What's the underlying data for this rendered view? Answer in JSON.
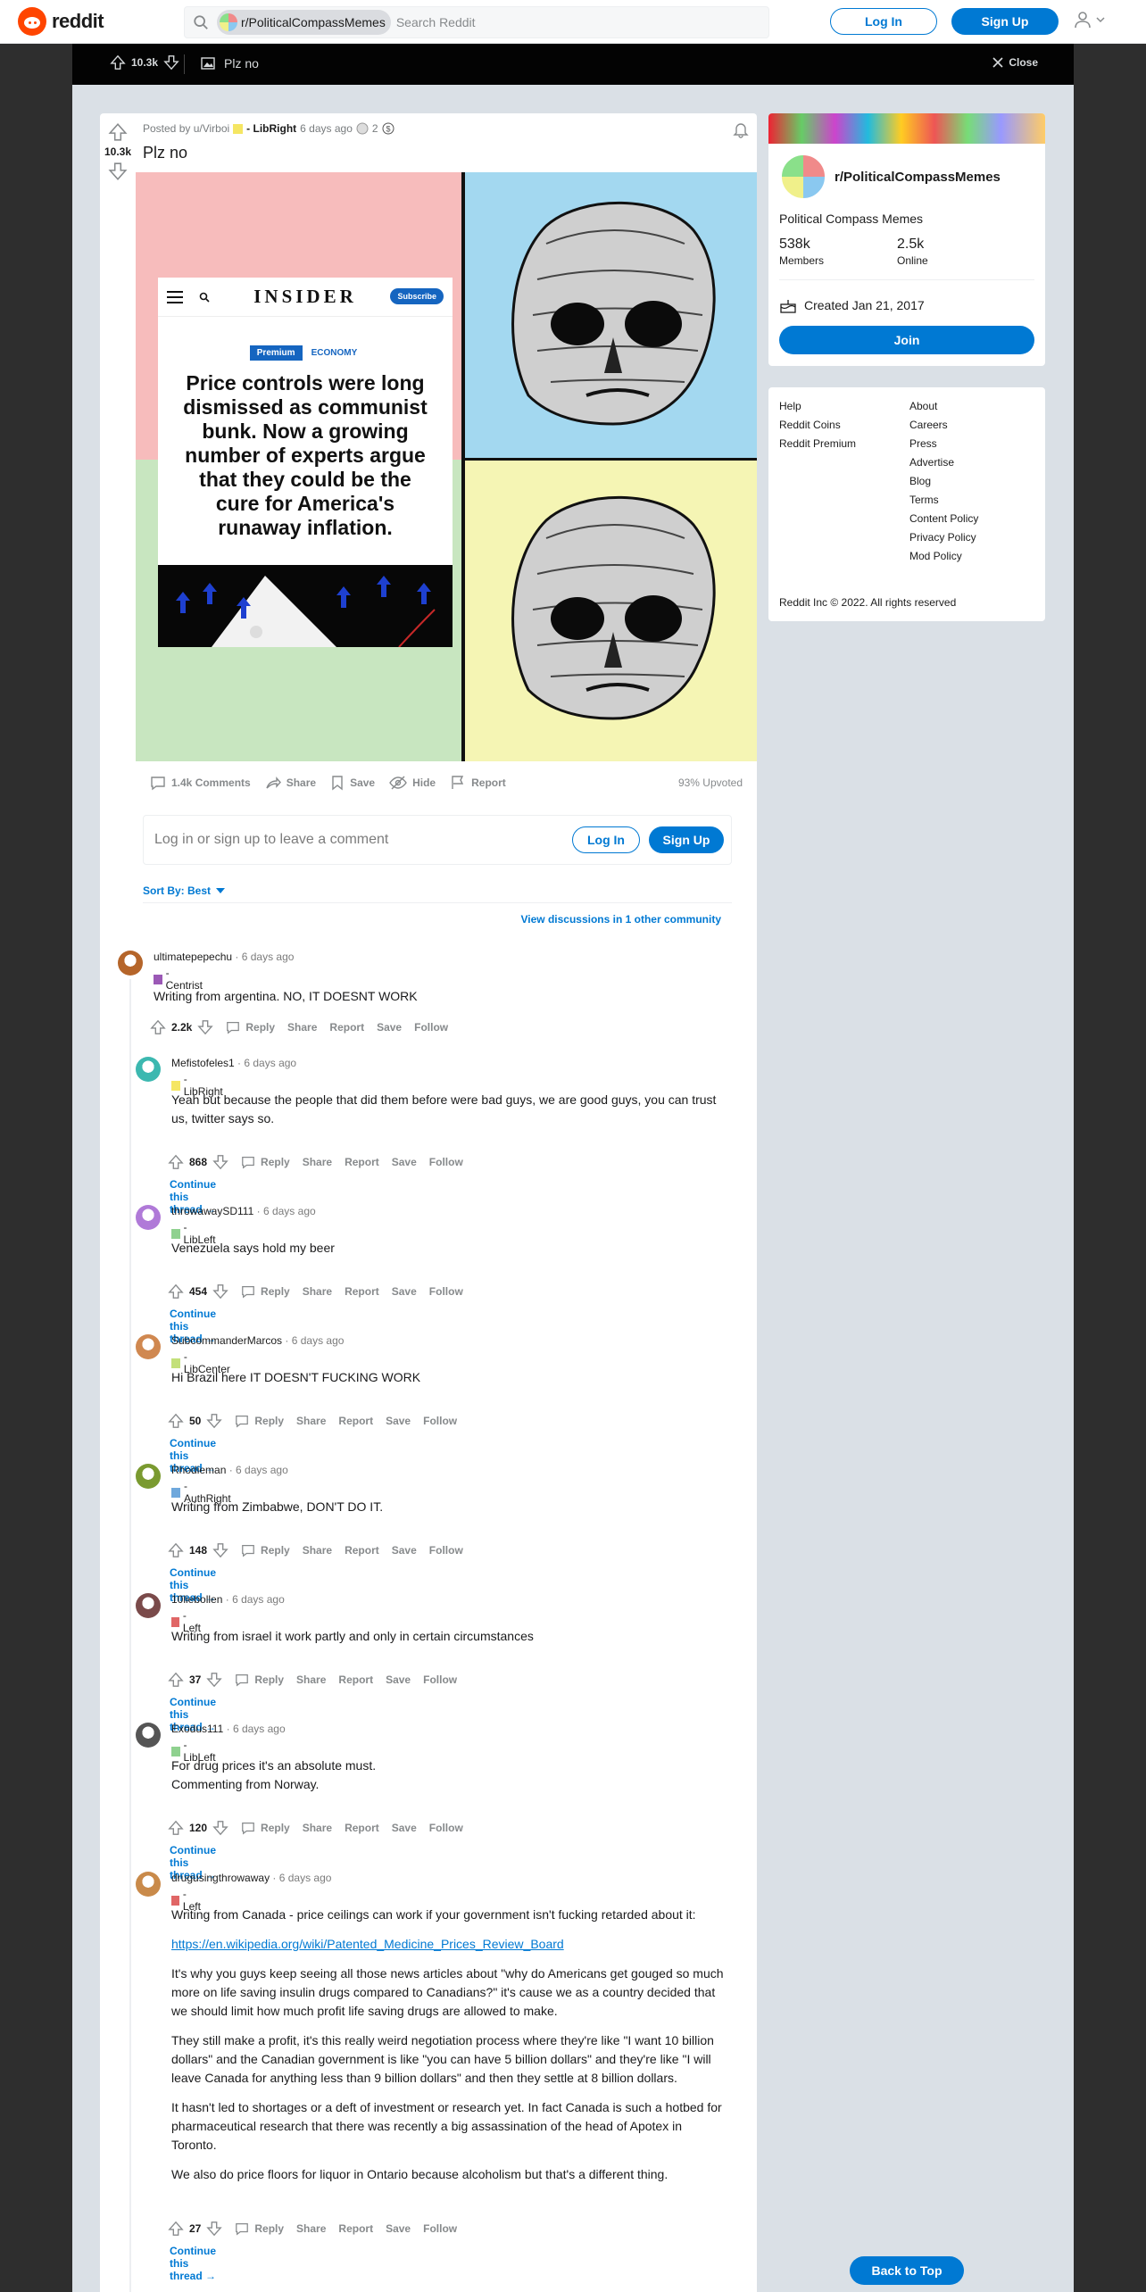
{
  "header": {
    "logo_text": "reddit",
    "subreddit_pill": "r/PoliticalCompassMemes",
    "search_placeholder": "Search Reddit",
    "login_label": "Log In",
    "signup_label": "Sign Up"
  },
  "topbar": {
    "vote_count": "10.3k",
    "title": "Plz no",
    "close_label": "Close"
  },
  "post": {
    "posted_by": "Posted by u/Virboi",
    "author_flair": "- LibRight",
    "time": "6 days ago",
    "award_count": "2",
    "vote_count": "10.3k",
    "title": "Plz no",
    "meme": {
      "brand": "INSIDER",
      "subscribe": "Subscribe",
      "tag_premium": "Premium",
      "tag_section": "ECONOMY",
      "headline": "Price controls were long dismissed as communist bunk. Now a growing number of experts argue that they could be the cure for America's runaway inflation."
    },
    "actions": {
      "comments": "1.4k Comments",
      "share": "Share",
      "save": "Save",
      "hide": "Hide",
      "report": "Report",
      "upvoted": "93% Upvoted"
    }
  },
  "comment_box": {
    "prompt": "Log in or sign up to leave a comment",
    "login": "Log In",
    "signup": "Sign Up"
  },
  "sort_label": "Sort By: Best",
  "view_discussions": "View discussions in 1 other community",
  "comment_actions": {
    "reply": "Reply",
    "share": "Share",
    "report": "Report",
    "save": "Save",
    "follow": "Follow"
  },
  "continue_thread": "Continue this thread →",
  "comments": [
    {
      "author": "ultimatepepechu",
      "time": "· 6 days ago",
      "flair": "- Centrist",
      "flair_color": "#9b59b6",
      "body": [
        "Writing from argentina. NO, IT DOESNT WORK"
      ],
      "score": "2.2k"
    },
    {
      "author": "Mefistofeles1",
      "time": "· 6 days ago",
      "flair": "- LibRight",
      "flair_color": "#f5e663",
      "body": [
        "Yeah but because the people that did them before were bad guys, we are good guys, you can trust us, twitter says so."
      ],
      "score": "868"
    },
    {
      "author": "throwawaySD111",
      "time": "· 6 days ago",
      "flair": "- LibLeft",
      "flair_color": "#8fd18f",
      "body": [
        "Venezuela says hold my beer"
      ],
      "score": "454"
    },
    {
      "author": "SubcommanderMarcos",
      "time": "· 6 days ago",
      "flair": "- LibCenter",
      "flair_color": "#c3e07a",
      "body": [
        "Hi Brazil here IT DOESN'T FUCKING WORK"
      ],
      "score": "50"
    },
    {
      "author": "Rhodieman",
      "time": "· 6 days ago",
      "flair": "- AuthRight",
      "flair_color": "#6fa8dc",
      "body": [
        "Writing from Zimbabwe, DON'T DO IT."
      ],
      "score": "148"
    },
    {
      "author": "10liebollen",
      "time": "· 6 days ago",
      "flair": "- Left",
      "flair_color": "#e06666",
      "body": [
        "Writing from israel it work partly and only in certain circumstances"
      ],
      "score": "37"
    },
    {
      "author": "Exodus111",
      "time": "· 6 days ago",
      "flair": "- LibLeft",
      "flair_color": "#8fd18f",
      "body": [
        "For drug prices it's an absolute must.",
        "Commenting from Norway."
      ],
      "score": "120"
    },
    {
      "author": "drugusingthrowaway",
      "time": "· 6 days ago",
      "flair": "- Left",
      "flair_color": "#e06666",
      "body": [
        "Writing from Canada - price ceilings can work if your government isn't fucking retarded about it:",
        "https://en.wikipedia.org/wiki/Patented_Medicine_Prices_Review_Board",
        "It's why you guys keep seeing all those news articles about \"why do Americans get gouged so much more on life saving insulin drugs compared to Canadians?\" it's cause we as a country decided that we should limit how much profit life saving drugs are allowed to make.",
        "They still make a profit, it's this really weird negotiation process where they're like \"I want 10 billion dollars\" and the Canadian government is like \"you can have 5 billion dollars\" and they're like \"I will leave Canada for anything less than 9 billion dollars\" and then they settle at 8 billion dollars.",
        "It hasn't led to shortages or a deft of investment or research yet. In fact Canada is such a hotbed for pharmaceutical research that there was recently a big assassination of the head of Apotex in Toronto.",
        "We also do price floors for liquor in Ontario because alcoholism but that's a different thing."
      ],
      "score": "27"
    }
  ],
  "sidebar": {
    "name": "r/PoliticalCompassMemes",
    "description": "Political Compass Memes",
    "members_num": "538k",
    "members_label": "Members",
    "online_num": "2.5k",
    "online_label": "Online",
    "created": "Created Jan 21, 2017",
    "join": "Join"
  },
  "footer": {
    "left_links": [
      "Help",
      "Reddit Coins",
      "Reddit Premium"
    ],
    "right_links": [
      "About",
      "Careers",
      "Press",
      "Advertise",
      "Blog",
      "Terms",
      "Content Policy",
      "Privacy Policy",
      "Mod Policy"
    ],
    "copyright": "Reddit Inc © 2022. All rights reserved"
  },
  "back_to_top": "Back to Top"
}
